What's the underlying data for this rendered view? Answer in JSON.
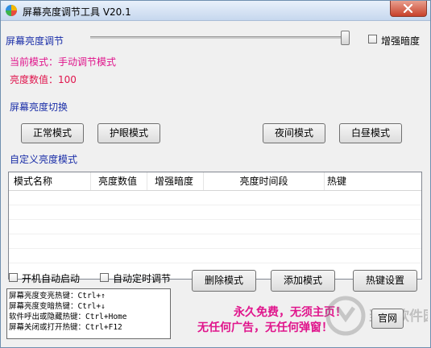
{
  "window": {
    "title": "屏幕亮度调节工具 V20.1"
  },
  "brightness": {
    "label": "屏幕亮度调节",
    "enhance_label": "增强暗度",
    "mode_text": "当前模式：手动调节模式",
    "value_text": "亮度数值：100",
    "level": 1.0
  },
  "switch_section": {
    "label": "屏幕亮度切换"
  },
  "mode_buttons": {
    "normal": "正常模式",
    "eye": "护眼模式",
    "night": "夜间模式",
    "day": "白昼模式"
  },
  "custom": {
    "label": "自定义亮度模式",
    "columns": [
      "模式名称",
      "亮度数值",
      "增强暗度",
      "亮度时间段",
      "热键"
    ],
    "rows": []
  },
  "options": {
    "autostart": "开机自动启动",
    "autotimer": "自动定时调节"
  },
  "actions": {
    "delete": "删除模式",
    "add": "添加模式",
    "hotkey": "热键设置",
    "website": "官网"
  },
  "hotkeys": [
    "屏幕亮度变亮热键：Ctrl+↑",
    "屏幕亮度变暗热键：Ctrl+↓",
    "软件呼出或隐藏热键：Ctrl+Home",
    "屏幕关闭或打开热键：Ctrl+F12"
  ],
  "promo": {
    "line1": "永久免费，无须主页！",
    "line2": "无任何广告，无任何弹窗！"
  },
  "watermark": {
    "text": "当下软件园"
  },
  "colors": {
    "section_blue": "#1a2ea8",
    "mode_magenta": "#e0158c",
    "value_red": "#e0154d",
    "promo_magenta": "#e0158c"
  }
}
